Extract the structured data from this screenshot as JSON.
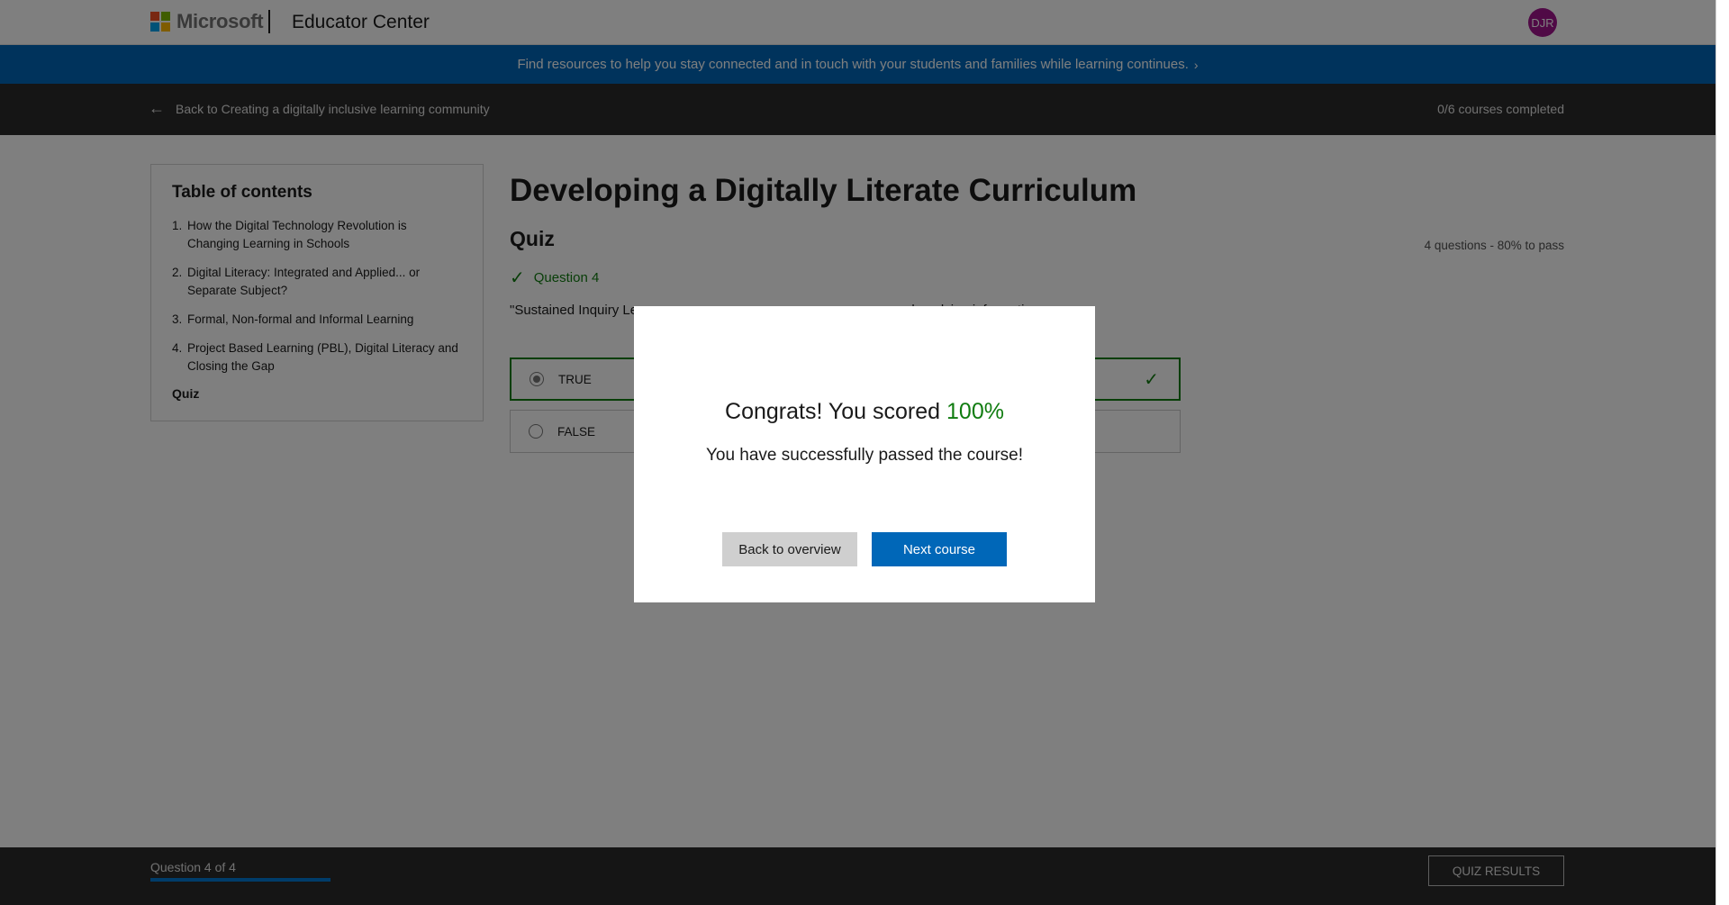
{
  "header": {
    "brand": "Microsoft",
    "site_title": "Educator Center",
    "avatar_initials": "DJR",
    "avatar_color": "#a0148c",
    "logo_colors": [
      "#f25022",
      "#7fba00",
      "#00a4ef",
      "#ffb900"
    ]
  },
  "banner": {
    "text": "Find resources to help you stay connected and in touch with your students and families while learning continues.",
    "chevron": "›"
  },
  "backbar": {
    "back_label": "Back to Creating a digitally inclusive learning community",
    "progress": "0/6 courses completed"
  },
  "toc": {
    "title": "Table of contents",
    "items": [
      {
        "num": "1.",
        "label": "How the Digital Technology Revolution is Changing Learning in Schools"
      },
      {
        "num": "2.",
        "label": "Digital Literacy: Integrated and Applied... or Separate Subject?"
      },
      {
        "num": "3.",
        "label": "Formal, Non-formal and Informal Learning"
      },
      {
        "num": "4.",
        "label": "Project Based Learning (PBL), Digital Literacy and Closing the Gap"
      }
    ],
    "quiz_label": "Quiz"
  },
  "main": {
    "course_title": "Developing a Digitally Literate Curriculum",
    "quiz_heading": "Quiz",
    "quiz_meta": "4 questions - 80% to pass",
    "question_label": "Question 4",
    "question_text": "\"Sustained Inquiry Le                                                              es, and applying information",
    "options": [
      {
        "label": "TRUE",
        "selected": true,
        "correct": true
      },
      {
        "label": "FALSE",
        "selected": false,
        "correct": false
      }
    ]
  },
  "footer": {
    "progress_label": "Question 4 of 4",
    "progress_fraction": 1.0,
    "results_button": "QUIZ RESULTS"
  },
  "modal": {
    "score_prefix": "Congrats! You scored",
    "score_value": "100%",
    "message": "You have successfully passed the course!",
    "back_button": "Back to overview",
    "next_button": "Next course"
  },
  "colors": {
    "accent": "#0067b8",
    "success": "#107c10"
  }
}
